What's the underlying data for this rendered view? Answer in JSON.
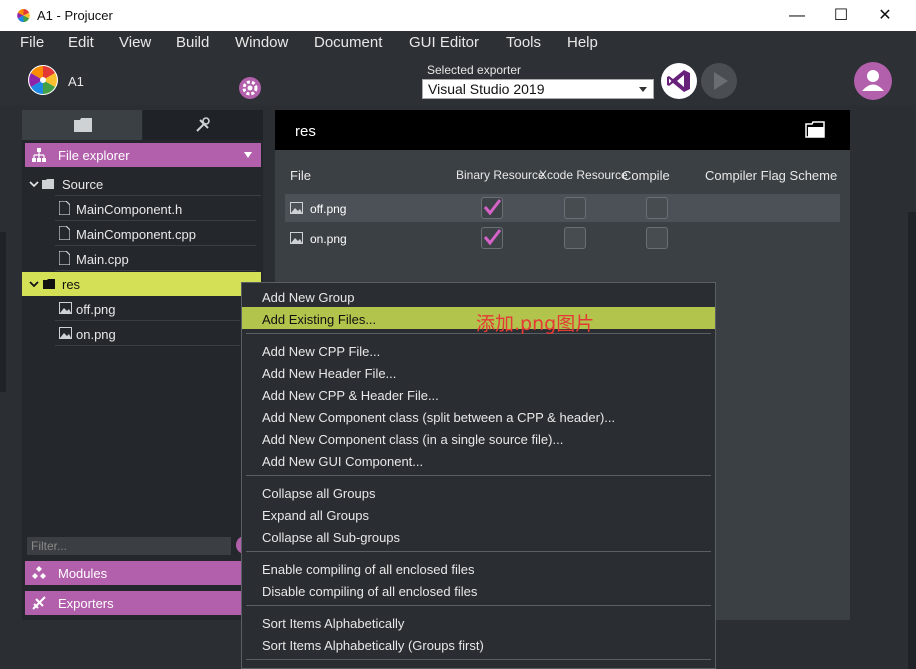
{
  "window": {
    "title": "A1 - Projucer",
    "minimize": "—",
    "maximize": "☐",
    "close": "✕"
  },
  "menu": [
    "File",
    "Edit",
    "View",
    "Build",
    "Window",
    "Document",
    "GUI Editor",
    "Tools",
    "Help"
  ],
  "header": {
    "project_name": "A1",
    "exporter_label": "Selected exporter",
    "exporter_value": "Visual Studio 2019"
  },
  "sidebar": {
    "file_explorer": "File explorer",
    "tree": [
      {
        "label": "Source",
        "type": "group",
        "expanded": true
      },
      {
        "label": "MainComponent.h",
        "type": "file"
      },
      {
        "label": "MainComponent.cpp",
        "type": "file"
      },
      {
        "label": "Main.cpp",
        "type": "file"
      },
      {
        "label": "res",
        "type": "group",
        "expanded": true,
        "selected": true
      },
      {
        "label": "off.png",
        "type": "image"
      },
      {
        "label": "on.png",
        "type": "image"
      }
    ],
    "filter_placeholder": "Filter...",
    "modules": "Modules",
    "exporters": "Exporters"
  },
  "main": {
    "title": "res",
    "columns": [
      "File",
      "Binary Resource",
      "Xcode Resource",
      "Compile",
      "Compiler Flag Scheme"
    ],
    "rows": [
      {
        "name": "off.png",
        "binary": true,
        "xcode": false,
        "compile": false
      },
      {
        "name": "on.png",
        "binary": true,
        "xcode": false,
        "compile": false
      }
    ]
  },
  "context_menu": {
    "group1": [
      "Add New Group",
      "Add Existing Files..."
    ],
    "group2": [
      "Add New CPP File...",
      "Add New Header File...",
      "Add New CPP & Header File...",
      "Add New Component class (split between a CPP & header)...",
      "Add New Component class (in a single source file)...",
      "Add New GUI Component..."
    ],
    "group3": [
      "Collapse all Groups",
      "Expand all Groups",
      "Collapse all Sub-groups"
    ],
    "group4": [
      "Enable compiling of all enclosed files",
      "Disable compiling of all enclosed files"
    ],
    "group5": [
      "Sort Items Alphabetically",
      "Sort Items Alphabetically (Groups first)"
    ],
    "highlighted": "Add Existing Files..."
  },
  "annotation": "添加.png图片",
  "colors": {
    "accent": "#b25fac",
    "selection": "#d4e157",
    "menu_highlight": "#b3c44c",
    "annotation": "#e53935"
  }
}
